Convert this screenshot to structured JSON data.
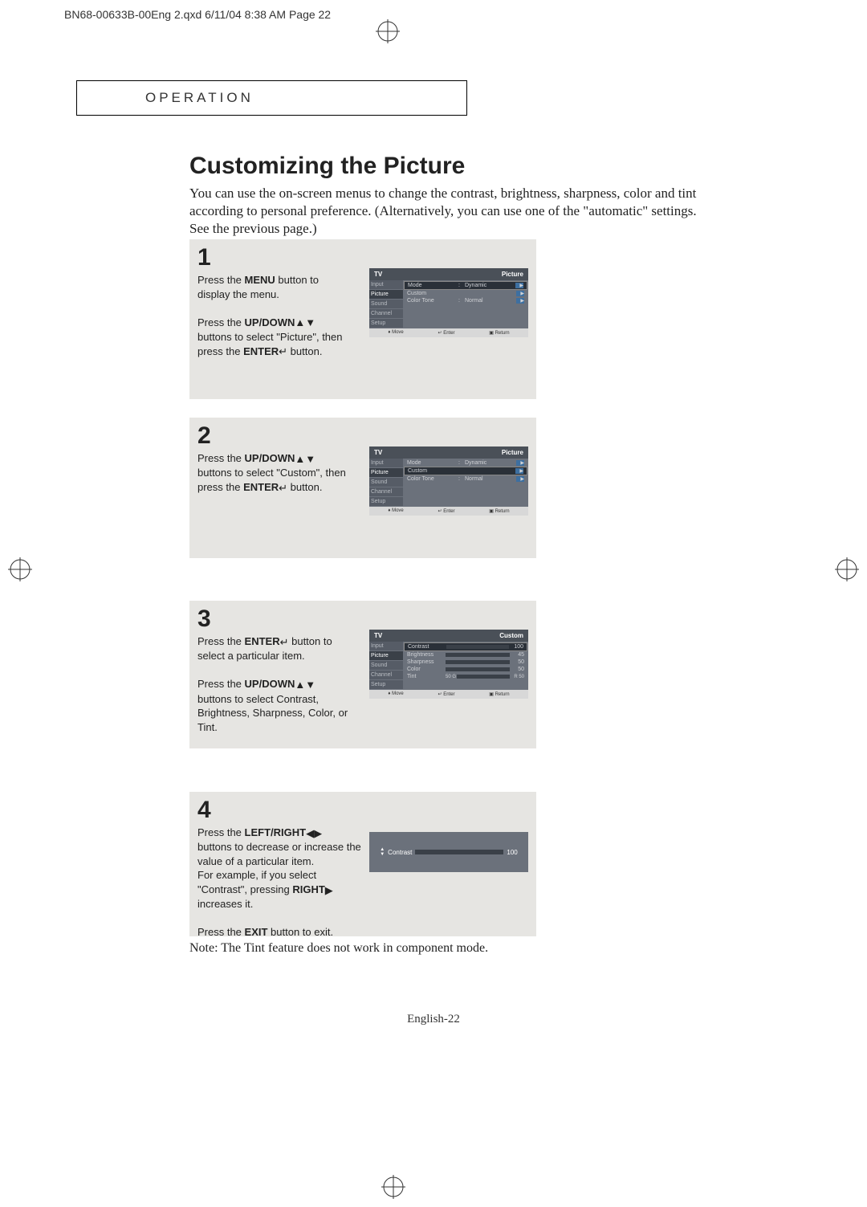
{
  "header_line": "BN68-00633B-00Eng 2.qxd  6/11/04 8:38 AM  Page 22",
  "section": "OPERATION",
  "title": "Customizing the Picture",
  "intro": "You can use the on-screen menus to change the contrast, brightness, sharpness, color and tint according to personal preference.\n(Alternatively, you can use one of the \"automatic\" settings. See the previous page.)",
  "steps": {
    "s1": {
      "num": "1",
      "p1a": "Press the ",
      "p1b": "MENU",
      "p1c": " button to display the menu.",
      "p2a": "Press the ",
      "p2b": "UP/DOWN",
      "p2c": " buttons to select \"Picture\", then press the ",
      "p2d": "ENTER",
      "p2e": " button."
    },
    "s2": {
      "num": "2",
      "p1a": "Press the ",
      "p1b": "UP/DOWN",
      "p1c": " buttons to select \"Custom\", then press the ",
      "p1d": "ENTER",
      "p1e": " button."
    },
    "s3": {
      "num": "3",
      "p1a": "Press the ",
      "p1b": "ENTER",
      "p1c": " button to select a particular item.",
      "p2a": "Press the ",
      "p2b": "UP/DOWN",
      "p2c": " buttons to select Contrast, Brightness, Sharpness, Color, or Tint."
    },
    "s4": {
      "num": "4",
      "p1a": "Press the ",
      "p1b": "LEFT/RIGHT",
      "p1c": " buttons to decrease or increase the value of a particular item.",
      "p1d": "For example, if you select \"Contrast\", pressing ",
      "p1e": "RIGHT",
      "p1f": " increases it.",
      "p2a": "Press the ",
      "p2b": "EXIT",
      "p2c": " button to exit."
    }
  },
  "menu": {
    "tv_label": "TV",
    "picture_label": "Picture",
    "custom_label": "Custom",
    "sidebar": [
      "Input",
      "Picture",
      "Sound",
      "Channel",
      "Setup"
    ],
    "rows1": [
      {
        "label": "Mode",
        "value": "Dynamic",
        "hl": true
      },
      {
        "label": "Custom",
        "value": "",
        "hl": false
      },
      {
        "label": "Color Tone",
        "value": "Normal",
        "hl": false
      }
    ],
    "rows2": [
      {
        "label": "Mode",
        "value": "Dynamic",
        "hl": false
      },
      {
        "label": "Custom",
        "value": "",
        "hl": true
      },
      {
        "label": "Color Tone",
        "value": "Normal",
        "hl": false
      }
    ],
    "custom_rows": [
      {
        "label": "Contrast",
        "value": "100",
        "pct": 100,
        "hl": true
      },
      {
        "label": "Brightness",
        "value": "45",
        "pct": 45,
        "hl": false
      },
      {
        "label": "Sharpness",
        "value": "50",
        "pct": 50,
        "hl": false
      },
      {
        "label": "Color",
        "value": "50",
        "pct": 50,
        "hl": false
      }
    ],
    "tint_row": {
      "label": "Tint",
      "g": "50 G",
      "r": "R 50",
      "pct": 50
    },
    "footer": {
      "move": "Move",
      "enter": "Enter",
      "return": "Return"
    }
  },
  "contrast_adjust": {
    "label": "Contrast",
    "value": "100",
    "pct": 100
  },
  "note": "Note: The Tint feature does not work in component mode.",
  "page_footer": "English-22"
}
